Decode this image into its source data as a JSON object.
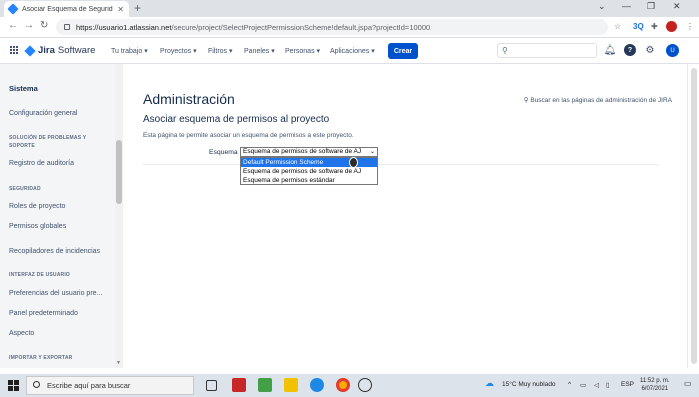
{
  "browser": {
    "tab_title": "Asociar Esquema de Seguridad de",
    "url_host": "https://usuario1.atlassian.net",
    "url_path": "/secure/project/SelectProjectPermissionScheme!default.jspa?projectId=10000"
  },
  "header": {
    "product_bold": "Jira",
    "product_rest": "Software",
    "menu": [
      "Tu trabajo ▾",
      "Proyectos ▾",
      "Filtros ▾",
      "Paneles ▾",
      "Personas ▾",
      "Aplicaciones ▾"
    ],
    "create_label": "Crear",
    "user_initial": "U"
  },
  "sidebar": {
    "title": "Sistema",
    "items": {
      "config": "Configuración general",
      "sec_troubleshoot": "SOLUCIÓN DE PROBLEMAS Y SOPORTE",
      "audit": "Registro de auditoría",
      "sec_security": "SEGURIDAD",
      "roles": "Roles de proyecto",
      "global_perms": "Permisos globales",
      "issue_collectors": "Recopiladores de incidencias",
      "sec_ui": "INTERFAZ DE USUARIO",
      "user_prefs": "Preferencias del usuario pre...",
      "default_dash": "Panel predeterminado",
      "look": "Aspecto",
      "sec_import": "IMPORTAR Y EXPORTAR"
    }
  },
  "main": {
    "page_title": "Administración",
    "admin_search": "Buscar en las páginas de administración de JIRA",
    "section_title": "Asociar esquema de permisos al proyecto",
    "description": "Esta página te permite asociar un esquema de permisos a este proyecto.",
    "scheme_label": "Esquema",
    "select_value": "Esquema de permisos de software de AJ",
    "options": [
      "Default Permission Scheme",
      "Esquema de permisos de software de AJ",
      "Esquema de permisos estándar"
    ],
    "selected_option_index": 0
  },
  "taskbar": {
    "search_placeholder": "Escribe aquí para buscar",
    "weather": "15°C  Muy nublado",
    "language": "ESP",
    "time": "11:52 p. m.",
    "date": "6/07/2021"
  }
}
